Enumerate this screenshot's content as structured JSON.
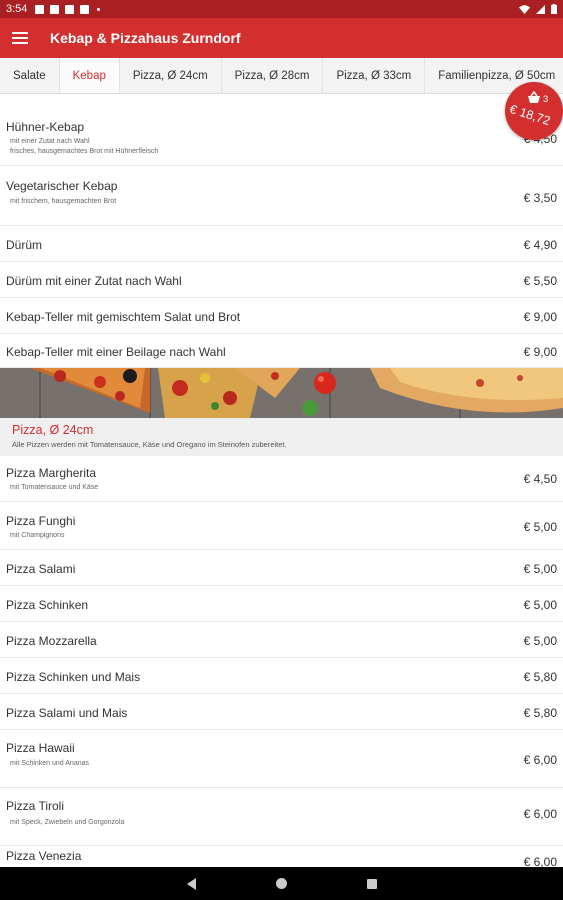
{
  "status": {
    "time": "3:54"
  },
  "app": {
    "title": "Kebap & Pizzahaus Zurndorf"
  },
  "tabs": [
    {
      "label": "Salate"
    },
    {
      "label": "Kebap"
    },
    {
      "label": "Pizza, Ø 24cm"
    },
    {
      "label": "Pizza, Ø 28cm"
    },
    {
      "label": "Pizza, Ø 33cm"
    },
    {
      "label": "Familienpizza, Ø 50cm"
    }
  ],
  "active_tab": "Kebap",
  "cart": {
    "count": "3",
    "total": "€ 18,72"
  },
  "kebap_items": [
    {
      "name": "Hühner-Kebap",
      "desc": "mit einer Zutat nach Wahl",
      "desc2": "frisches, hausgemachtes Brot mit Hühnerfleisch",
      "price": "€ 4,50"
    },
    {
      "name": "Vegetarischer Kebap",
      "desc": "mit frischem, hausgemachten Brot",
      "price": "€ 3,50"
    },
    {
      "name": "Dürüm",
      "price": "€ 4,90"
    },
    {
      "name": "Dürüm mit einer Zutat nach Wahl",
      "price": "€ 5,50"
    },
    {
      "name": "Kebap-Teller mit gemischtem Salat und Brot",
      "price": "€ 9,00"
    },
    {
      "name": "Kebap-Teller mit einer Beilage nach Wahl",
      "price": "€ 9,00"
    }
  ],
  "pizza_section": {
    "title": "Pizza, Ø 24cm",
    "desc": "Alle Pizzen werden mit Tomatensauce, Käse und Oregano im Steinofen zubereitet."
  },
  "pizza_items": [
    {
      "name": "Pizza Margherita",
      "desc": "mit Tomatensauce und Käse",
      "price": "€ 4,50"
    },
    {
      "name": "Pizza Funghi",
      "desc": "mit Champignons",
      "price": "€ 5,00"
    },
    {
      "name": "Pizza Salami",
      "price": "€ 5,00"
    },
    {
      "name": "Pizza Schinken",
      "price": "€ 5,00"
    },
    {
      "name": "Pizza Mozzarella",
      "price": "€ 5,00"
    },
    {
      "name": "Pizza Schinken und Mais",
      "price": "€ 5,80"
    },
    {
      "name": "Pizza Salami und Mais",
      "price": "€ 5,80"
    },
    {
      "name": "Pizza Hawaii",
      "desc": "mit Schinken und Ananas",
      "price": "€ 6,00"
    },
    {
      "name": "Pizza Tiroli",
      "desc": "mit Speck, Zwiebeln und Gorgonzola",
      "price": "€ 6,00"
    },
    {
      "name": "Pizza Venezia",
      "price": "€ 6,00"
    }
  ],
  "colors": {
    "primary": "#d32f2f",
    "status_bar": "#a91f22"
  }
}
